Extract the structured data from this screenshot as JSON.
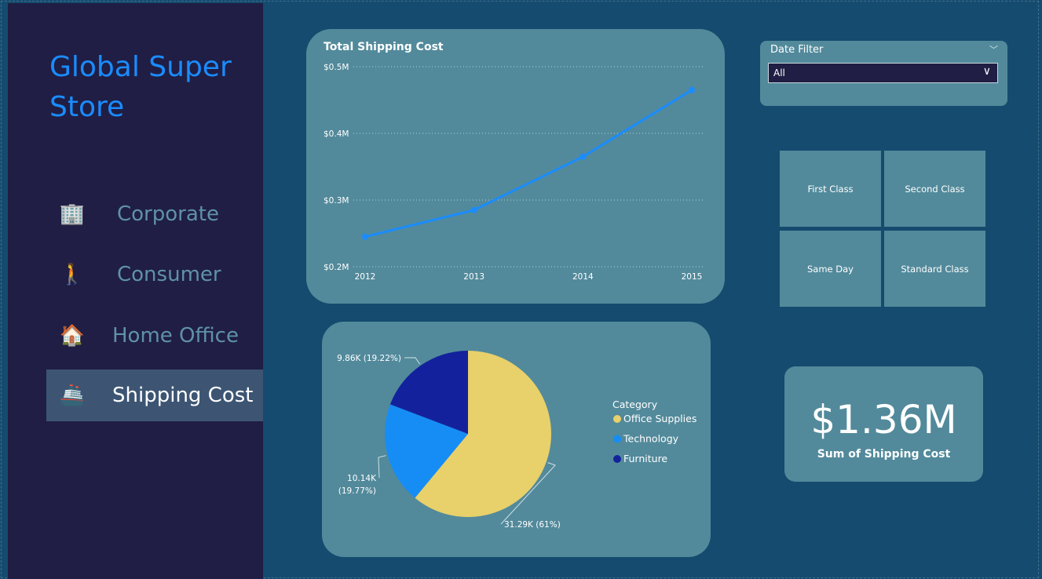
{
  "sidebar": {
    "title": "Global Super Store",
    "items": [
      {
        "label": "Corporate",
        "icon": "office-building-icon",
        "glyph": "🏢"
      },
      {
        "label": "Consumer",
        "icon": "person-walking-icon",
        "glyph": "🚶"
      },
      {
        "label": "Home Office",
        "icon": "house-icon",
        "glyph": "🏠"
      },
      {
        "label": "Shipping Cost",
        "icon": "ship-icon",
        "glyph": "🚢"
      }
    ],
    "active": "Shipping Cost"
  },
  "date_filter": {
    "label": "Date Filter",
    "selected": "All"
  },
  "ship_modes": [
    "First Class",
    "Second Class",
    "Same Day",
    "Standard Class"
  ],
  "kpi": {
    "value": "$1.36M",
    "label": "Sum of Shipping Cost"
  },
  "chart_data": [
    {
      "type": "line",
      "title": "Total Shipping Cost",
      "x": [
        "2012",
        "2013",
        "2014",
        "2015"
      ],
      "series": [
        {
          "values": [
            0.245,
            0.285,
            0.365,
            0.465
          ],
          "color": "#1a8cff"
        }
      ],
      "y_unit": "M",
      "ylim": [
        0.2,
        0.5
      ],
      "yticks": [
        "$0.2M",
        "$0.3M",
        "$0.4M",
        "$0.5M"
      ],
      "grid": true
    },
    {
      "type": "pie",
      "legend_title": "Category",
      "legend_placement": "right",
      "slices": [
        {
          "name": "Office Supplies",
          "value": 31.29,
          "percent": 61,
          "label": "31.29K (61%)",
          "color": "#e8d06a"
        },
        {
          "name": "Technology",
          "value": 10.14,
          "percent": 19.77,
          "label_line1": "10.14K",
          "label_line2": "(19.77%)",
          "color": "#168df5"
        },
        {
          "name": "Furniture",
          "value": 9.86,
          "percent": 19.22,
          "label": "9.86K (19.22%)",
          "color": "#13229c"
        }
      ]
    }
  ]
}
